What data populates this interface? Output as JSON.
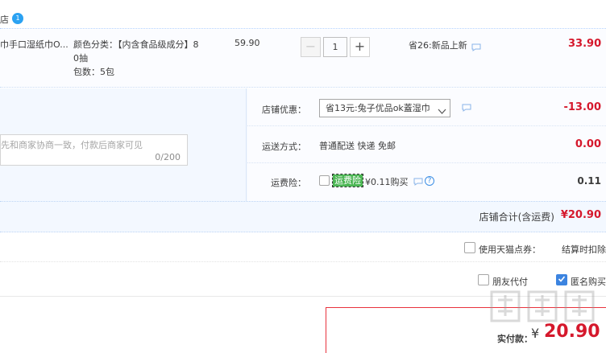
{
  "shop": {
    "name": "店",
    "badge": "1"
  },
  "item": {
    "title": "巾手口湿纸巾O...",
    "props_line1": "颜色分类：【内含食品级成分】8",
    "props_line2": "0抽",
    "props_line3": "包数：5包",
    "price": "59.90",
    "qty_minus": "−",
    "qty_value": "1",
    "qty_plus": "+",
    "save": "省26:新品上新",
    "sum": "33.90"
  },
  "memo": {
    "placeholder": "先和商家协商一致，付款后商家可见",
    "count": "0/200"
  },
  "coupon": {
    "label": "店铺优惠：",
    "selected": "省13元:兔子优品ok蓋湿巾",
    "amount": "-13.00"
  },
  "shipping": {
    "label": "运送方式：",
    "method": "普通配送 快递 免邮",
    "amount": "0.00"
  },
  "insurance": {
    "label": "运费险：",
    "tag": "运费险",
    "price": "¥0.11购买",
    "help": "?",
    "amount": "0.11"
  },
  "shop_total": {
    "label": "店铺合计(含运费)",
    "value": "¥20.90"
  },
  "points": {
    "label": "使用天猫点券：",
    "value": "结算时扣除"
  },
  "pay_options": {
    "friend": "朋友代付",
    "anonymous": "匿名购买"
  },
  "total": {
    "label": "实付款：",
    "currency": "¥",
    "value": "20.90"
  },
  "colors": {
    "accent_red": "#d5182c",
    "checkbox_blue": "#3c84e0",
    "insurance_green": "#4cb654"
  },
  "icons": [
    "chat-bubble-icon",
    "chevron-down-icon",
    "help-circle-icon",
    "check-icon"
  ]
}
